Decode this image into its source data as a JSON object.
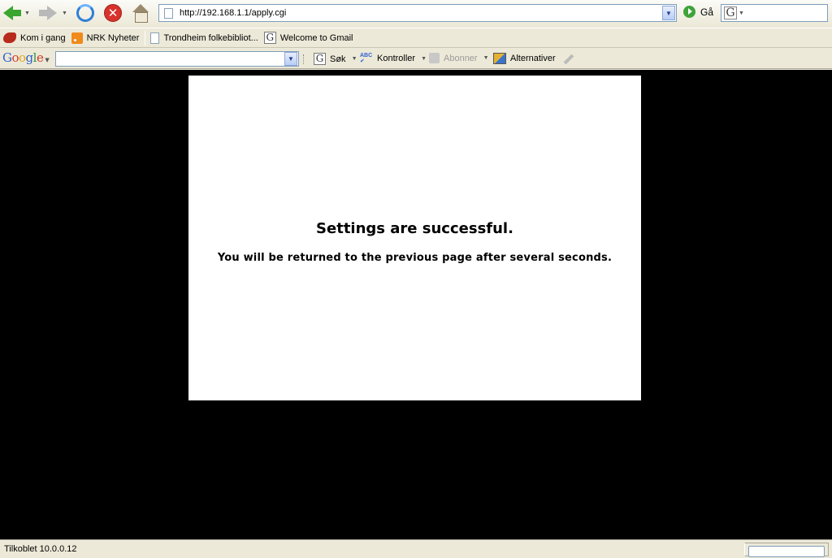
{
  "address_bar": {
    "url": "http://192.168.1.1/apply.cgi",
    "go_label": "Gå"
  },
  "bookmarks": [
    {
      "label": "Kom i gang",
      "icon": "firefox-icon"
    },
    {
      "label": "NRK Nyheter",
      "icon": "rss-feed-icon"
    },
    {
      "label": "Trondheim folkebibliot...",
      "icon": "page-icon"
    },
    {
      "label": "Welcome to Gmail",
      "icon": "google-icon"
    }
  ],
  "google_toolbar": {
    "logo": "Google",
    "search_label": "Søk",
    "check_label": "Kontroller",
    "subscribe_label": "Abonner",
    "options_label": "Alternativer"
  },
  "page": {
    "title": "Settings are successful.",
    "message": "You will be returned to the previous page after several seconds."
  },
  "status_bar": {
    "text": "Tilkoblet 10.0.0.12"
  },
  "colors": {
    "page_background": "#000000",
    "panel_background": "#ffffff",
    "chrome": "#ece9d8"
  }
}
